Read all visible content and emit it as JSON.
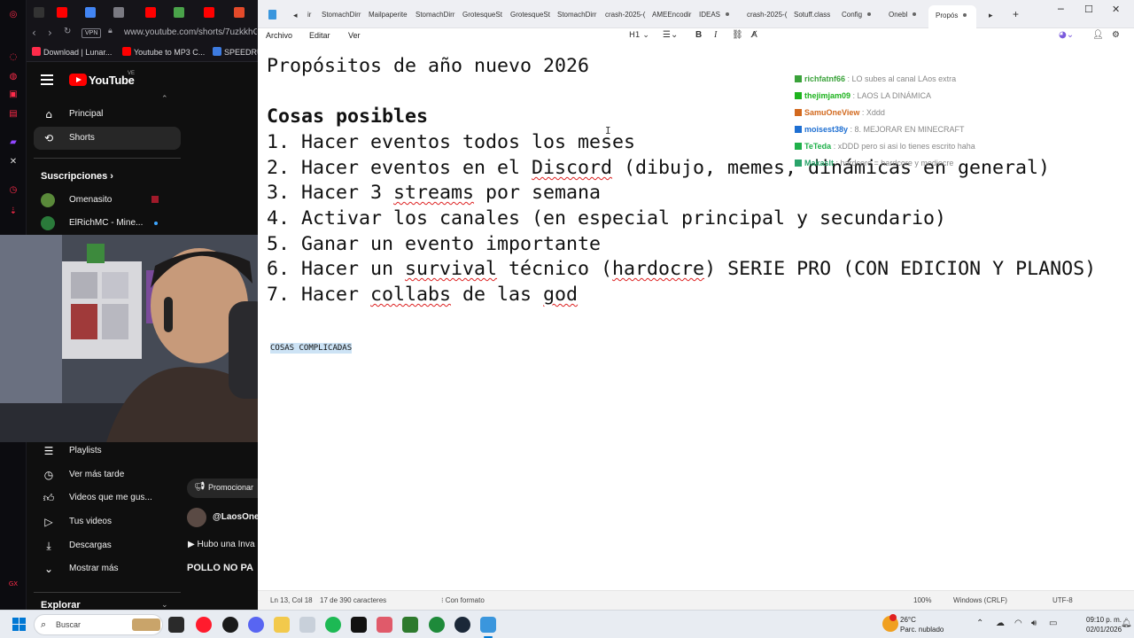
{
  "browser": {
    "url": "www.youtube.com/shorts/7uzkkhG",
    "vpn_label": "VPN",
    "bookmarks": [
      "Download | Lunar...",
      "Youtube to MP3 C...",
      "SPEEDRU"
    ],
    "colors": {
      "accent": "#ff2b4a"
    }
  },
  "youtube": {
    "logo_text": "YouTube",
    "country_code": "VE",
    "nav": [
      "Principal",
      "Shorts"
    ],
    "subscriptions_heading": "Suscripciones",
    "subscriptions": [
      "Omenasito",
      "ElRichMC - Mine..."
    ],
    "you_items": [
      "Playlists",
      "Ver más tarde",
      "Videos que me gus...",
      "Tus videos",
      "Descargas",
      "Mostrar más"
    ],
    "explore_heading": "Explorar",
    "promo_label": "Promocionar",
    "channel_handle": "@LaosOne",
    "comment_text": "Hubo una Inva",
    "title_text": "POLLO NO PA"
  },
  "notepad": {
    "tabs": [
      "ir",
      "StomachDirr",
      "Mailpaperite",
      "StomachDirr",
      "GrotesqueSt",
      "GrotesqueSt",
      "StomachDirr",
      "crash-2025-(",
      "AMEEncodir",
      "IDEAS",
      "crash-2025-(",
      "Sotuff.class",
      "Config",
      "Onebl",
      "Propós"
    ],
    "menu": [
      "Archivo",
      "Editar",
      "Ver"
    ],
    "heading_style": "H1",
    "lines": [
      "Propósitos de año nuevo 2026",
      "",
      "Cosas posibles",
      "1. Hacer eventos todos los meses",
      "2. Hacer eventos en el Discord (dibujo, memes, dinámicas en general)",
      "3. Hacer 3 streams por semana",
      "4. Activar los canales (en especial principal y secundario)",
      "5. Ganar un evento importante",
      "6. Hacer un survival técnico (hardocre) SERIE PRO (CON EDICION Y PLANOS)",
      "7. Hacer collabs de las god"
    ],
    "selected_text": "COSAS COMPLICADAS",
    "status": {
      "position": "Ln 13, Col 18",
      "chars": "17 de 390 caracteres",
      "format": "Con formato",
      "zoom": "100%",
      "line_ending": "Windows (CRLF)",
      "encoding": "UTF-8"
    }
  },
  "chat": [
    {
      "user": "richfatnf66",
      "text": ": LO subes al canal LAos extra",
      "color": "#3aa23a"
    },
    {
      "user": "thejimjam09",
      "text": ": LAOS LA DINÁMICA",
      "color": "#1db31d"
    },
    {
      "user": "SamuOneView",
      "text": ": Xddd",
      "color": "#d2691e"
    },
    {
      "user": "moisest38y",
      "text": ": 8. MEJORAR EN MINECRAFT",
      "color": "#1e6fd2"
    },
    {
      "user": "TeTeda",
      "text": ": xDDD pero si asi lo tienes escrito haha",
      "color": "#1fb04a"
    },
    {
      "user": "Makaslt",
      "text": ": hardcore = hardcore y mediocre",
      "color": "#2aa36a"
    }
  ],
  "taskbar": {
    "search_placeholder": "Buscar",
    "weather_temp": "26°C",
    "weather_desc": "Parc. nublado",
    "time": "09:10 p. m.",
    "date": "02/01/2026"
  }
}
